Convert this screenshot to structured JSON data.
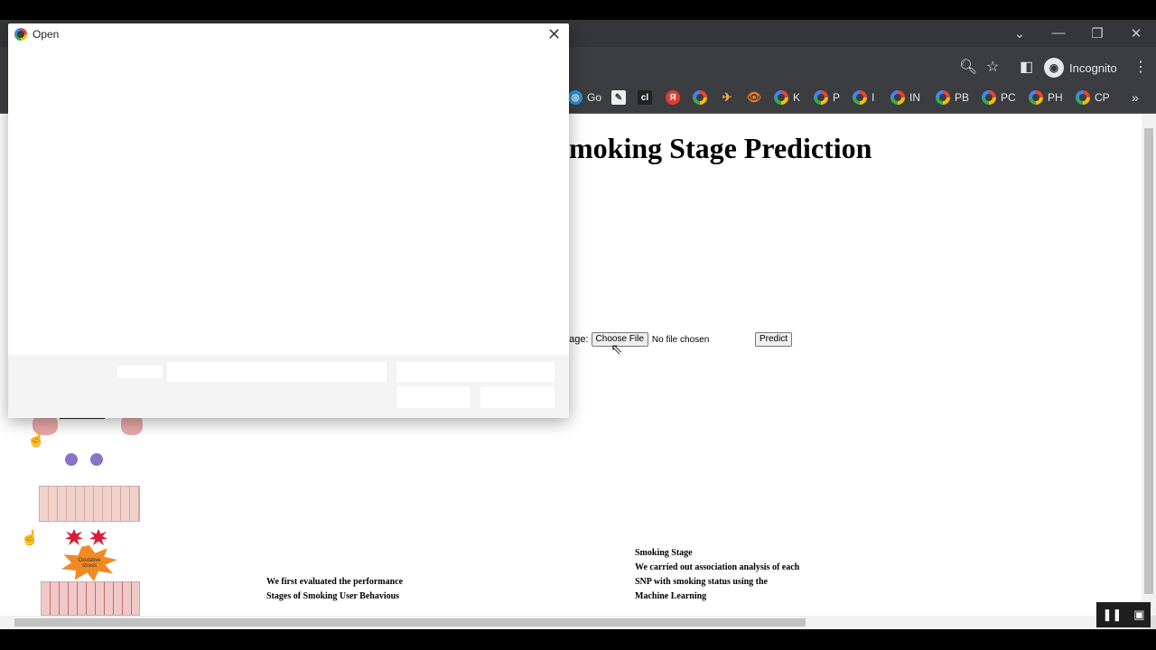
{
  "browser": {
    "profile_label": "Incognito",
    "window_controls": [
      "—",
      "❐",
      "✕"
    ],
    "bookmarks": [
      {
        "label": "Go",
        "icon": "globe-icon"
      },
      {
        "label": "",
        "icon": "pen-icon"
      },
      {
        "label": "",
        "icon": "cl-icon",
        "text": "cl"
      },
      {
        "label": "",
        "icon": "yandex-icon",
        "text": "Я"
      },
      {
        "label": "",
        "icon": "google-icon"
      },
      {
        "label": "",
        "icon": "plane-icon"
      },
      {
        "label": "",
        "icon": "eye-icon"
      },
      {
        "label": "K",
        "icon": "google-icon"
      },
      {
        "label": "P",
        "icon": "google-icon"
      },
      {
        "label": "I",
        "icon": "google-icon"
      },
      {
        "label": "IN",
        "icon": "google-icon"
      },
      {
        "label": "PB",
        "icon": "google-icon"
      },
      {
        "label": "PC",
        "icon": "google-icon"
      },
      {
        "label": "PH",
        "icon": "google-icon"
      },
      {
        "label": "CP",
        "icon": "google-icon"
      }
    ],
    "more_label": "»"
  },
  "page": {
    "heading": "moking Stage Prediction",
    "image_label": "nage:",
    "choose_file_label": "Choose File",
    "no_file_label": "No file chosen",
    "predict_label": "Predict",
    "para_left": [
      "We first evaluated the performance",
      "Stages of Smoking User Behavious"
    ],
    "para_right": [
      "Smoking Stage",
      "We carried out association analysis of each",
      "SNP with smoking status using the",
      "Machine Learning"
    ],
    "illustration_label": "Oxidative stress"
  },
  "dialog": {
    "title": "Open",
    "close_icon": "✕"
  },
  "overlay": {
    "pause_icon": "❚❚",
    "pip_icon": "▣"
  }
}
